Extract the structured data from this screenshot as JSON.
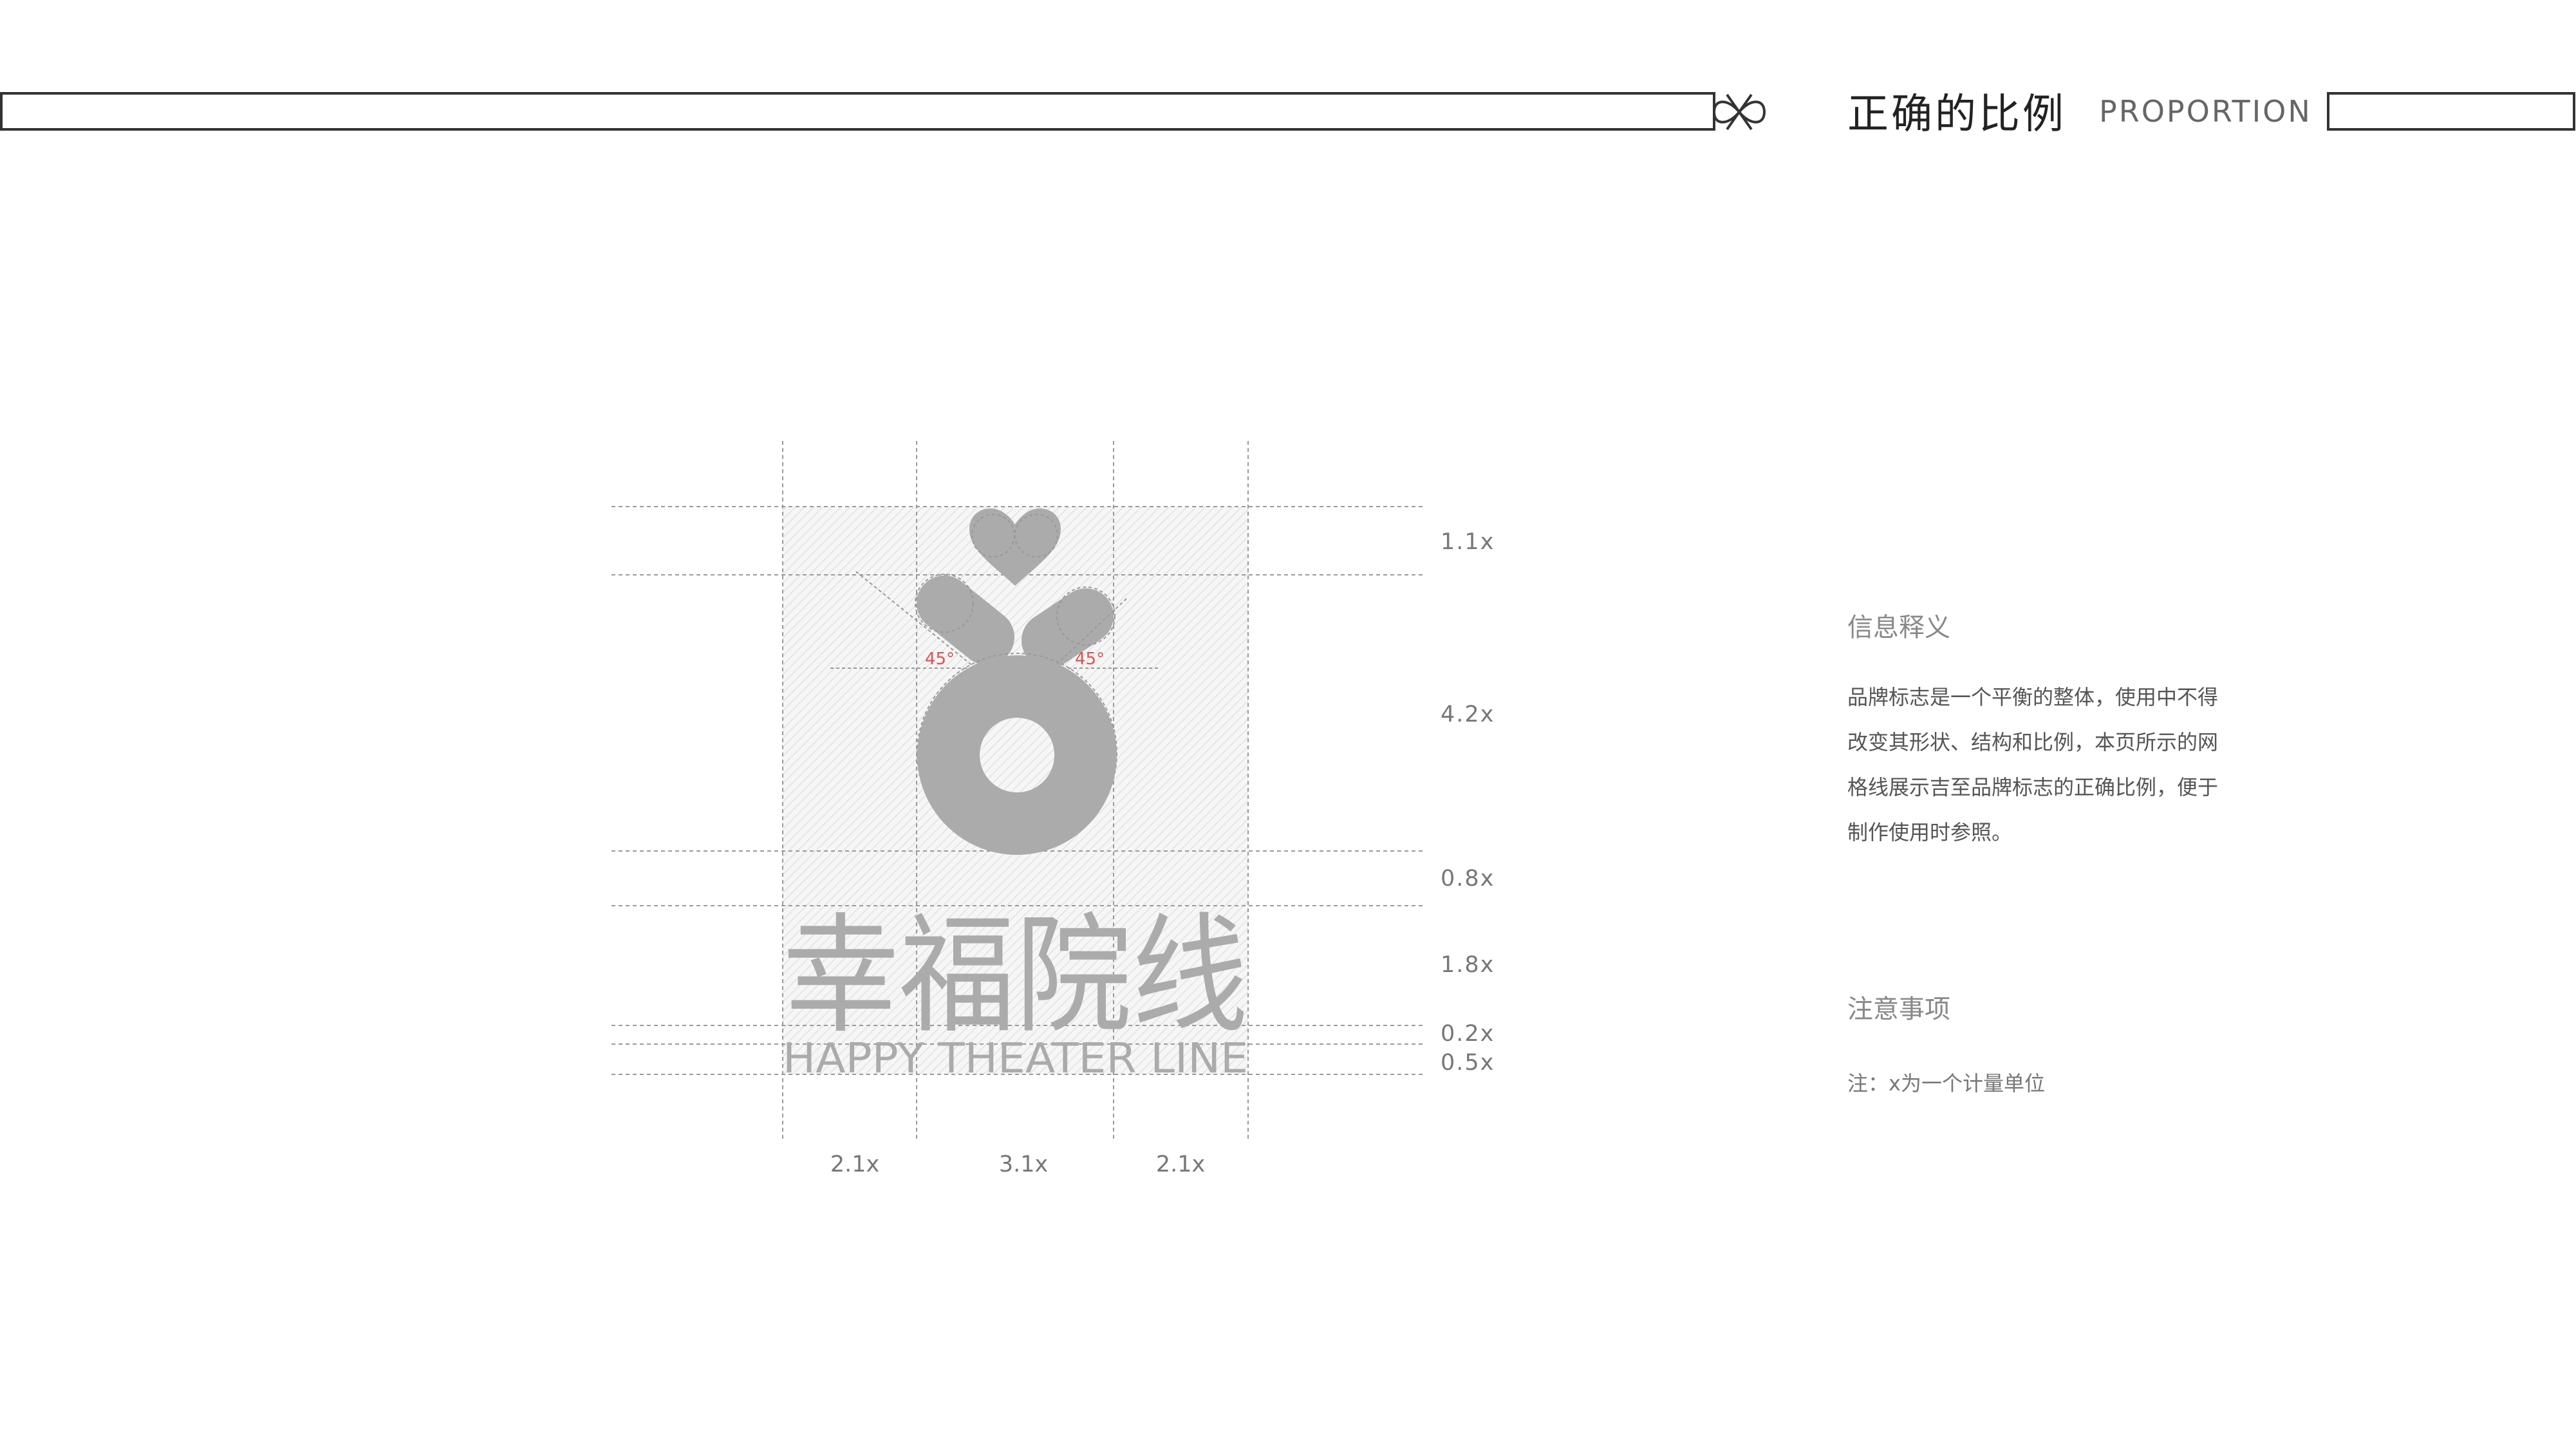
{
  "header": {
    "title_cn": "正确的比例",
    "title_en": "PROPORTION",
    "colors": {
      "line": "#333333"
    }
  },
  "logo": {
    "name_cn": "幸福院线",
    "name_en": "HAPPY THEATER LINE",
    "angle_label": "45°",
    "colors": {
      "mark": "#ababab",
      "grid": "#e8e8e8",
      "angle": "#e05050"
    },
    "icon": "heart-ring-logo-icon"
  },
  "dimensions": {
    "right": [
      "1.1x",
      "4.2x",
      "0.8x",
      "1.8x",
      "0.2x",
      "0.5x"
    ],
    "bottom": [
      "2.1x",
      "3.1x",
      "2.1x"
    ]
  },
  "info": {
    "heading": "信息释义",
    "lines": [
      "品牌标志是一个平衡的整体，使用中不得",
      "改变其形状、结构和比例，本页所示的网",
      "格线展示吉至品牌标志的正确比例，便于",
      "制作使用时参照。"
    ]
  },
  "notice": {
    "heading": "注意事项",
    "text": "注：x为一个计量单位"
  }
}
